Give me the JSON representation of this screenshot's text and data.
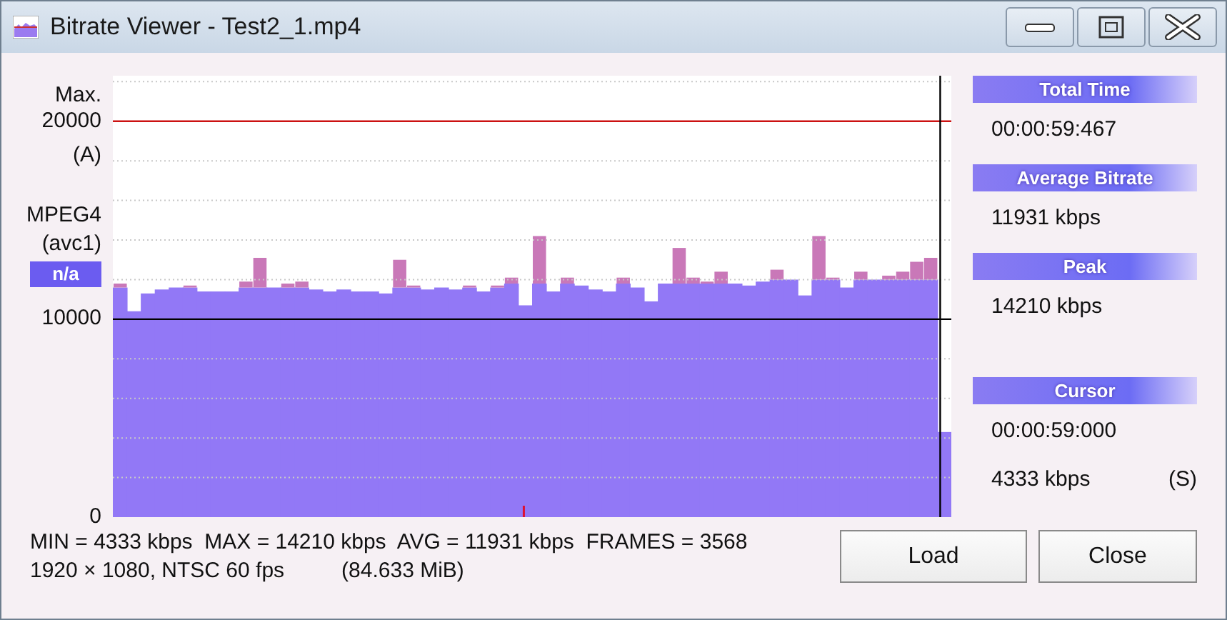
{
  "window": {
    "title": "Bitrate Viewer - Test2_1.mp4"
  },
  "axis_labels": {
    "max_label": "Max.",
    "max_mode": "(A)",
    "codec": "MPEG4",
    "codec_tag": "(avc1)",
    "badge": "n/a"
  },
  "chart": {
    "chart_data": {
      "type": "bar",
      "ylim": [
        0,
        22300
      ],
      "yticks": [
        {
          "value": 0,
          "label": "0"
        },
        {
          "value": 10000,
          "label": "10000"
        },
        {
          "value": 20000,
          "label": "20000"
        }
      ],
      "stacked": true,
      "series": [
        {
          "color": "#9278f6",
          "values": [
            11600,
            10400,
            11300,
            11500,
            11600,
            11600,
            11400,
            11400,
            11400,
            11600,
            11600,
            11600,
            11600,
            11600,
            11500,
            11400,
            11500,
            11400,
            11400,
            11300,
            11600,
            11600,
            11500,
            11600,
            11500,
            11600,
            11400,
            11600,
            11800,
            10700,
            11800,
            11400,
            11800,
            11700,
            11500,
            11400,
            11800,
            11600,
            10900,
            11800,
            11800,
            11800,
            11800,
            11800,
            11800,
            11700,
            11900,
            12000,
            12000,
            11200,
            12000,
            12000,
            11600,
            12000,
            12000,
            12000,
            12000,
            12000,
            12000,
            4300
          ]
        },
        {
          "color": "#c978b8",
          "values": [
            200,
            0,
            0,
            0,
            0,
            100,
            0,
            0,
            0,
            300,
            1500,
            0,
            200,
            300,
            0,
            0,
            0,
            0,
            0,
            0,
            1400,
            100,
            0,
            0,
            0,
            100,
            0,
            100,
            300,
            0,
            2400,
            0,
            300,
            0,
            0,
            0,
            300,
            0,
            0,
            0,
            1800,
            300,
            100,
            600,
            0,
            0,
            0,
            500,
            0,
            0,
            2200,
            100,
            0,
            400,
            0,
            200,
            400,
            900,
            1100,
            0
          ]
        }
      ],
      "ref_lines": [
        {
          "axis": "y",
          "value": 20000,
          "color": "#cc1111"
        }
      ]
    }
  },
  "panel": {
    "sections": [
      {
        "header": "Total Time",
        "lines": [
          {
            "text": "00:00:59:467"
          }
        ]
      },
      {
        "header": "Average Bitrate",
        "lines": [
          {
            "text": "11931 kbps"
          }
        ]
      },
      {
        "header": "Peak",
        "lines": [
          {
            "text": "14210 kbps"
          }
        ]
      },
      {
        "header": "Cursor",
        "lines": [
          {
            "text": "00:00:59:000"
          },
          {
            "text": "4333 kbps",
            "mode": "(S)"
          }
        ]
      }
    ]
  },
  "stats": {
    "summary": "MIN = 4333 kbps  MAX = 14210 kbps  AVG = 11931 kbps  FRAMES = 3568",
    "format": "1920 × 1080, NTSC 60 fps",
    "size": "(84.633 MiB)"
  },
  "buttons": [
    "Load",
    "Close"
  ]
}
